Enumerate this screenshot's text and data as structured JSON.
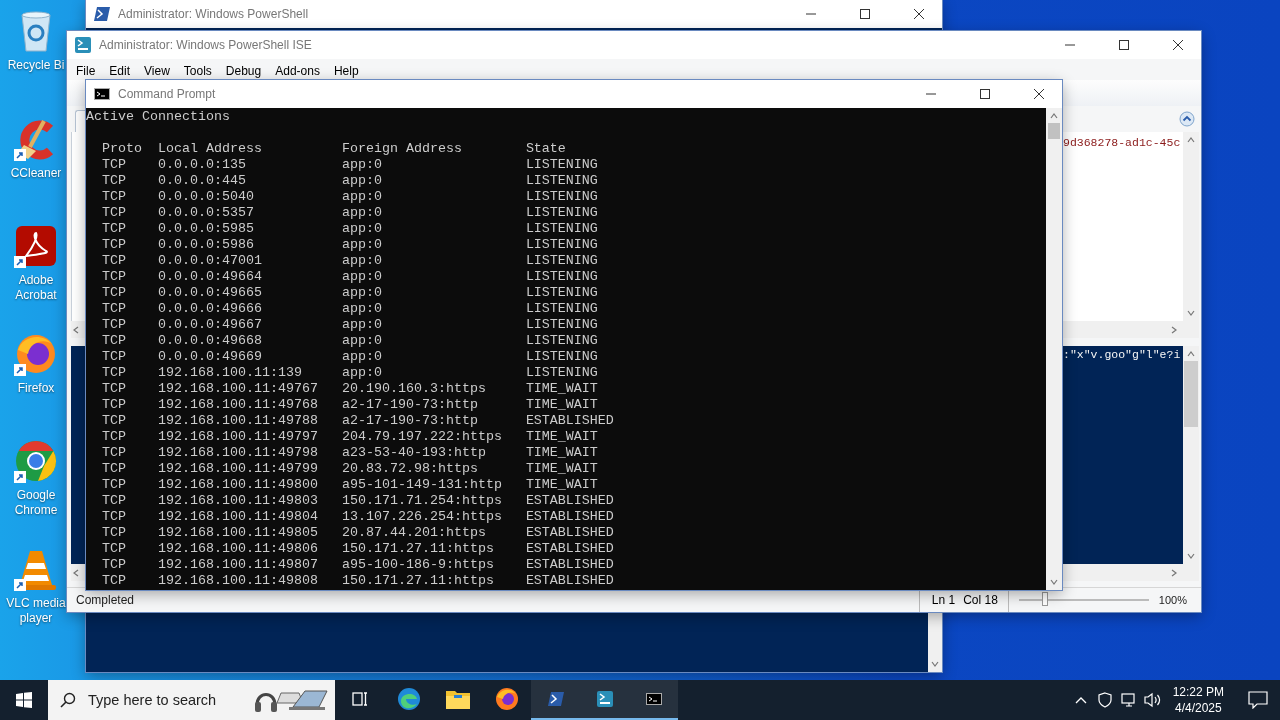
{
  "desktop_icons": [
    {
      "label": "Recycle Bi",
      "kind": "recycle-bin",
      "shortcut": false
    },
    {
      "label": "CCleaner",
      "kind": "ccleaner",
      "shortcut": true
    },
    {
      "label": "Adobe Acrobat",
      "kind": "acrobat",
      "shortcut": true
    },
    {
      "label": "Firefox",
      "kind": "firefox",
      "shortcut": true
    },
    {
      "label": "Google Chrome",
      "kind": "chrome",
      "shortcut": true
    },
    {
      "label": "VLC media player",
      "kind": "vlc",
      "shortcut": true
    }
  ],
  "powershell_window": {
    "title": "Administrator: Windows PowerShell"
  },
  "ise_window": {
    "title": "Administrator: Windows PowerShell ISE",
    "menu": [
      "File",
      "Edit",
      "View",
      "Tools",
      "Debug",
      "Add-ons",
      "Help"
    ],
    "script_text": "9d368278-ad1c-45c",
    "console_text": ":\"x\"v.goo\"g\"l\"e?i",
    "status": "Completed",
    "cursor_line": "Ln 1",
    "cursor_col": "Col 18",
    "zoom_slider": {
      "level": 0.2
    },
    "zoom": "100%"
  },
  "cmd_window": {
    "title": "Command Prompt",
    "heading": "Active Connections",
    "columns": [
      "Proto",
      "Local Address",
      "Foreign Address",
      "State"
    ],
    "rows": [
      [
        "TCP",
        "0.0.0.0:135",
        "app:0",
        "LISTENING"
      ],
      [
        "TCP",
        "0.0.0.0:445",
        "app:0",
        "LISTENING"
      ],
      [
        "TCP",
        "0.0.0.0:5040",
        "app:0",
        "LISTENING"
      ],
      [
        "TCP",
        "0.0.0.0:5357",
        "app:0",
        "LISTENING"
      ],
      [
        "TCP",
        "0.0.0.0:5985",
        "app:0",
        "LISTENING"
      ],
      [
        "TCP",
        "0.0.0.0:5986",
        "app:0",
        "LISTENING"
      ],
      [
        "TCP",
        "0.0.0.0:47001",
        "app:0",
        "LISTENING"
      ],
      [
        "TCP",
        "0.0.0.0:49664",
        "app:0",
        "LISTENING"
      ],
      [
        "TCP",
        "0.0.0.0:49665",
        "app:0",
        "LISTENING"
      ],
      [
        "TCP",
        "0.0.0.0:49666",
        "app:0",
        "LISTENING"
      ],
      [
        "TCP",
        "0.0.0.0:49667",
        "app:0",
        "LISTENING"
      ],
      [
        "TCP",
        "0.0.0.0:49668",
        "app:0",
        "LISTENING"
      ],
      [
        "TCP",
        "0.0.0.0:49669",
        "app:0",
        "LISTENING"
      ],
      [
        "TCP",
        "192.168.100.11:139",
        "app:0",
        "LISTENING"
      ],
      [
        "TCP",
        "192.168.100.11:49767",
        "20.190.160.3:https",
        "TIME_WAIT"
      ],
      [
        "TCP",
        "192.168.100.11:49768",
        "a2-17-190-73:http",
        "TIME_WAIT"
      ],
      [
        "TCP",
        "192.168.100.11:49788",
        "a2-17-190-73:http",
        "ESTABLISHED"
      ],
      [
        "TCP",
        "192.168.100.11:49797",
        "204.79.197.222:https",
        "TIME_WAIT"
      ],
      [
        "TCP",
        "192.168.100.11:49798",
        "a23-53-40-193:http",
        "TIME_WAIT"
      ],
      [
        "TCP",
        "192.168.100.11:49799",
        "20.83.72.98:https",
        "TIME_WAIT"
      ],
      [
        "TCP",
        "192.168.100.11:49800",
        "a95-101-149-131:http",
        "TIME_WAIT"
      ],
      [
        "TCP",
        "192.168.100.11:49803",
        "150.171.71.254:https",
        "ESTABLISHED"
      ],
      [
        "TCP",
        "192.168.100.11:49804",
        "13.107.226.254:https",
        "ESTABLISHED"
      ],
      [
        "TCP",
        "192.168.100.11:49805",
        "20.87.44.201:https",
        "ESTABLISHED"
      ],
      [
        "TCP",
        "192.168.100.11:49806",
        "150.171.27.11:https",
        "ESTABLISHED"
      ],
      [
        "TCP",
        "192.168.100.11:49807",
        "a95-100-186-9:https",
        "ESTABLISHED"
      ],
      [
        "TCP",
        "192.168.100.11:49808",
        "150.171.27.11:https",
        "ESTABLISHED"
      ]
    ]
  },
  "taskbar": {
    "search_placeholder": "Type here to search",
    "apps": [
      {
        "kind": "edge",
        "running": false
      },
      {
        "kind": "explorer",
        "running": false
      },
      {
        "kind": "firefox",
        "running": false
      },
      {
        "kind": "powershell",
        "running": true
      },
      {
        "kind": "ise",
        "running": true
      },
      {
        "kind": "cmd",
        "running": true
      }
    ],
    "time": "12:22 PM",
    "date": "4/4/2025"
  }
}
